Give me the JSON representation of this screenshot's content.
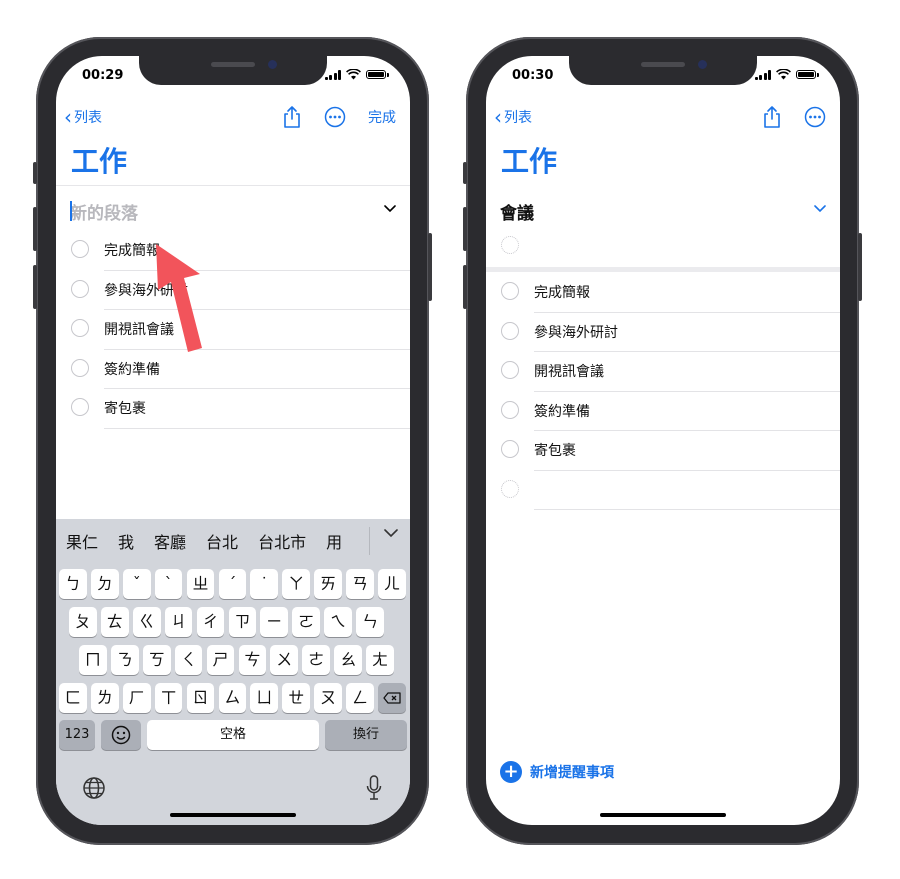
{
  "left_phone": {
    "status_time": "00:29",
    "back_label": "列表",
    "done_label": "完成",
    "title": "工作",
    "section_placeholder": "新的段落",
    "section_toggle_icon": "chevron-down-icon",
    "items": [
      "完成簡報",
      "參與海外研討",
      "開視訊會議",
      "簽約準備",
      "寄包裹"
    ],
    "keyboard": {
      "candidates": [
        "果仁",
        "我",
        "客廳",
        "台北",
        "台北市",
        "用"
      ],
      "row1": [
        "ㄅ",
        "ㄉ",
        "ˇ",
        "ˋ",
        "ㄓ",
        "ˊ",
        "˙",
        "ㄚ",
        "ㄞ",
        "ㄢ",
        "ㄦ"
      ],
      "row2": [
        "ㄆ",
        "ㄊ",
        "ㄍ",
        "ㄐ",
        "ㄔ",
        "ㄗ",
        "ㄧ",
        "ㄛ",
        "ㄟ",
        "ㄣ"
      ],
      "row3": [
        "ㄇ",
        "ㄋ",
        "ㄎ",
        "ㄑ",
        "ㄕ",
        "ㄘ",
        "ㄨ",
        "ㄜ",
        "ㄠ",
        "ㄤ"
      ],
      "row4": [
        "ㄈ",
        "ㄌ",
        "ㄏ",
        "ㄒ",
        "ㄖ",
        "ㄙ",
        "ㄩ",
        "ㄝ",
        "ㄡ",
        "ㄥ"
      ],
      "numbers_key": "123",
      "space_key": "空格",
      "return_key": "換行"
    }
  },
  "right_phone": {
    "status_time": "00:30",
    "back_label": "列表",
    "title": "工作",
    "section_name": "會議",
    "items": [
      "完成簡報",
      "參與海外研討",
      "開視訊會議",
      "簽約準備",
      "寄包裹"
    ],
    "add_label": "新增提醒事項"
  },
  "colors": {
    "accent": "#1a73e8",
    "arrow": "#f2545b",
    "phone_frame": "#2b2b2f",
    "keyboard_bg": "#d2d5db"
  }
}
